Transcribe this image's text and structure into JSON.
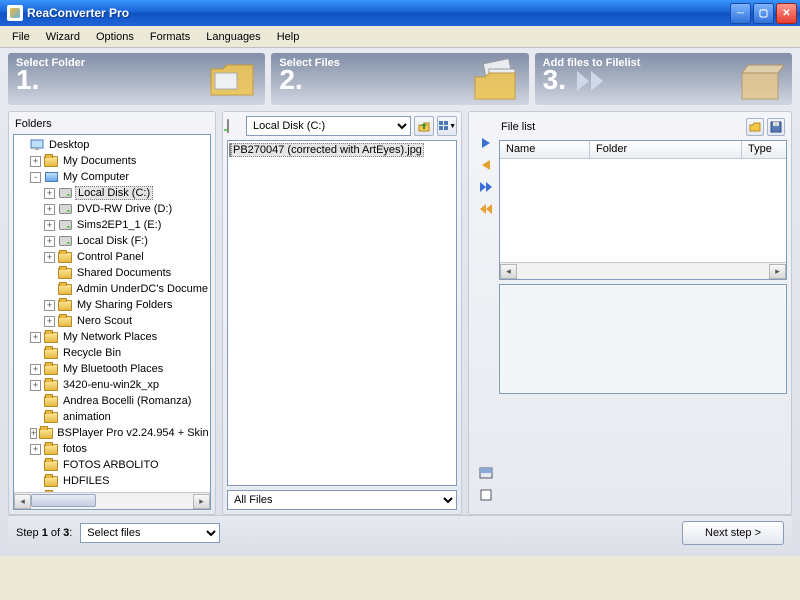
{
  "window": {
    "title": "ReaConverter Pro"
  },
  "menu": {
    "items": [
      "File",
      "Wizard",
      "Options",
      "Formats",
      "Languages",
      "Help"
    ]
  },
  "steps": {
    "s1": {
      "label": "Select Folder",
      "num": "1."
    },
    "s2": {
      "label": "Select Files",
      "num": "2."
    },
    "s3": {
      "label": "Add files to Filelist",
      "num": "3."
    }
  },
  "folders": {
    "header": "Folders",
    "tree": [
      {
        "pad": 0,
        "exp": "",
        "icon": "desktop",
        "text": "Desktop"
      },
      {
        "pad": 14,
        "exp": "+",
        "icon": "folder",
        "text": "My Documents"
      },
      {
        "pad": 14,
        "exp": "-",
        "icon": "monitor",
        "text": "My Computer"
      },
      {
        "pad": 28,
        "exp": "+",
        "icon": "disk",
        "text": "Local Disk (C:)",
        "selected": true
      },
      {
        "pad": 28,
        "exp": "+",
        "icon": "disk",
        "text": "DVD-RW Drive (D:)"
      },
      {
        "pad": 28,
        "exp": "+",
        "icon": "disk",
        "text": "Sims2EP1_1 (E:)"
      },
      {
        "pad": 28,
        "exp": "+",
        "icon": "disk",
        "text": "Local Disk (F:)"
      },
      {
        "pad": 28,
        "exp": "+",
        "icon": "folder",
        "text": "Control Panel"
      },
      {
        "pad": 28,
        "exp": "",
        "icon": "folder",
        "text": "Shared Documents"
      },
      {
        "pad": 28,
        "exp": "",
        "icon": "folder",
        "text": "Admin UnderDC's Docume"
      },
      {
        "pad": 28,
        "exp": "+",
        "icon": "folder",
        "text": "My Sharing Folders"
      },
      {
        "pad": 28,
        "exp": "+",
        "icon": "folder",
        "text": "Nero Scout"
      },
      {
        "pad": 14,
        "exp": "+",
        "icon": "folder",
        "text": "My Network Places"
      },
      {
        "pad": 14,
        "exp": "",
        "icon": "folder",
        "text": "Recycle Bin"
      },
      {
        "pad": 14,
        "exp": "+",
        "icon": "folder",
        "text": "My Bluetooth Places"
      },
      {
        "pad": 14,
        "exp": "+",
        "icon": "folder",
        "text": "3420-enu-win2k_xp"
      },
      {
        "pad": 14,
        "exp": "",
        "icon": "folder",
        "text": "Andrea Bocelli (Romanza)"
      },
      {
        "pad": 14,
        "exp": "",
        "icon": "folder",
        "text": "animation"
      },
      {
        "pad": 14,
        "exp": "+",
        "icon": "folder",
        "text": "BSPlayer Pro v2.24.954 + Skin"
      },
      {
        "pad": 14,
        "exp": "+",
        "icon": "folder",
        "text": "fotos"
      },
      {
        "pad": 14,
        "exp": "",
        "icon": "folder",
        "text": "FOTOS ARBOLITO"
      },
      {
        "pad": 14,
        "exp": "",
        "icon": "folder",
        "text": "HDFILES"
      },
      {
        "pad": 14,
        "exp": "+",
        "icon": "folder",
        "text": "images"
      }
    ]
  },
  "files": {
    "drive_selected": "Local Disk (C:)",
    "items": [
      {
        "text": "PB270047 (corrected with ArtEyes).jpg",
        "selected": true
      }
    ],
    "filter_selected": "All Files"
  },
  "filelist": {
    "header": "File list",
    "columns": [
      "Name",
      "Folder",
      "Type"
    ]
  },
  "status": {
    "step_prefix": "Step ",
    "step_bold": "1",
    "step_of": " of ",
    "step_total": "3",
    "step_colon": ":",
    "combo_selected": "Select files",
    "next": "Next step >"
  }
}
